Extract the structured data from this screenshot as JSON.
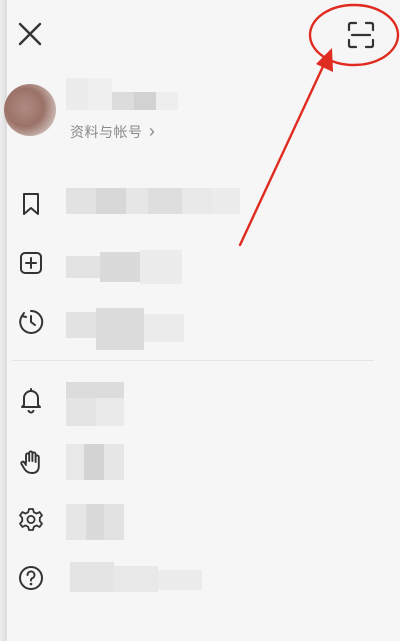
{
  "header": {
    "close_icon": "close-icon",
    "scan_icon": "scan-icon"
  },
  "profile": {
    "link_label": "资料与帐号",
    "chevron": "›"
  },
  "menu": {
    "group1": [
      {
        "icon": "bookmark-icon"
      },
      {
        "icon": "add-square-icon"
      },
      {
        "icon": "clock-icon"
      }
    ],
    "group2": [
      {
        "icon": "bell-icon"
      },
      {
        "icon": "hand-icon"
      },
      {
        "icon": "gear-icon"
      },
      {
        "icon": "help-icon"
      }
    ]
  },
  "annotation": {
    "color": "#e02b20",
    "marks": [
      "annotation-circle",
      "annotation-arrow"
    ]
  },
  "colors": {
    "background": "#f6f6f6",
    "text": "#333333",
    "muted": "#8a8a8a"
  }
}
